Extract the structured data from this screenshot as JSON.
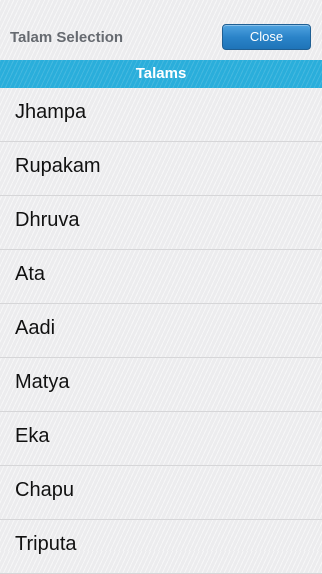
{
  "header": {
    "title": "Talam Selection",
    "close_label": "Close"
  },
  "section": {
    "title": "Talams"
  },
  "talams": [
    {
      "label": "Jhampa"
    },
    {
      "label": "Rupakam"
    },
    {
      "label": "Dhruva"
    },
    {
      "label": "Ata"
    },
    {
      "label": "Aadi"
    },
    {
      "label": "Matya"
    },
    {
      "label": "Eka"
    },
    {
      "label": "Chapu"
    },
    {
      "label": "Triputa"
    }
  ],
  "colors": {
    "accent": "#2aaedb",
    "button": "#2b84c9",
    "background": "#ececee"
  }
}
